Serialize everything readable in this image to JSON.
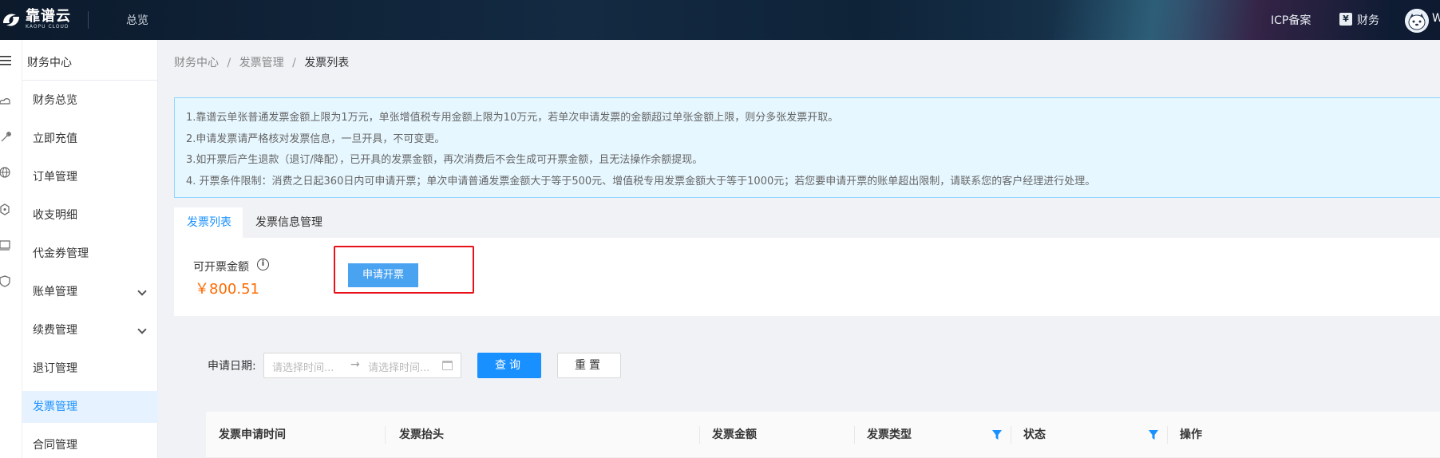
{
  "topbar": {
    "logo_text": "靠谱云",
    "logo_sub": "KAOPU CLOUD",
    "overview": "总览",
    "icp": "ICP备案",
    "finance_icon_glyph": "¥",
    "finance": "财务",
    "user_initial": "W"
  },
  "sidebar": {
    "title": "财务中心",
    "items": [
      {
        "label": "财务总览",
        "icon": "cloud-icon"
      },
      {
        "label": "立即充值",
        "icon": "wrench-icon"
      },
      {
        "label": "订单管理",
        "icon": "globe-icon"
      },
      {
        "label": "收支明细",
        "icon": "network-icon"
      },
      {
        "label": "代金券管理",
        "icon": "monitor-icon"
      },
      {
        "label": "账单管理",
        "icon": "shield-icon"
      },
      {
        "label": "续费管理"
      },
      {
        "label": "退订管理"
      },
      {
        "label": "发票管理"
      },
      {
        "label": "合同管理"
      }
    ]
  },
  "breadcrumb": {
    "level1": "财务中心",
    "level2": "发票管理",
    "current": "发票列表",
    "separator": "/"
  },
  "notice": {
    "lines": [
      "1.靠谱云单张普通发票金额上限为1万元，单张增值税专用金额上限为10万元，若单次申请发票的金额超过单张金额上限，则分多张发票开取。",
      "2.申请发票请严格核对发票信息，一旦开具，不可变更。",
      "3.如开票后产生退款（退订/降配），已开具的发票金额，再次消费后不会生成可开票金额，且无法操作余额提现。",
      "4. 开票条件限制：消费之日起360日内可申请开票；单次申请普通发票金额大于等于500元、增值税专用发票金额大于等于1000元；若您要申请开票的账单超出限制，请联系您的客户经理进行处理。"
    ]
  },
  "tabs": {
    "invoice_list": "发票列表",
    "invoice_info": "发票信息管理"
  },
  "amount": {
    "label": "可开票金额",
    "info_glyph": "i",
    "value": "￥800.51",
    "apply_button": "申请开票"
  },
  "filter": {
    "date_label": "申请日期:",
    "start_placeholder": "请选择时间...",
    "arrow": "→",
    "end_placeholder": "请选择时间...",
    "query_button": "查询",
    "reset_button": "重置"
  },
  "table": {
    "columns": [
      "发票申请时间",
      "发票抬头",
      "发票金额",
      "发票类型",
      "状态",
      "操作"
    ]
  },
  "colors": {
    "primary": "#1890ff",
    "amount": "#ff6a00",
    "highlight": "#e8121b"
  }
}
